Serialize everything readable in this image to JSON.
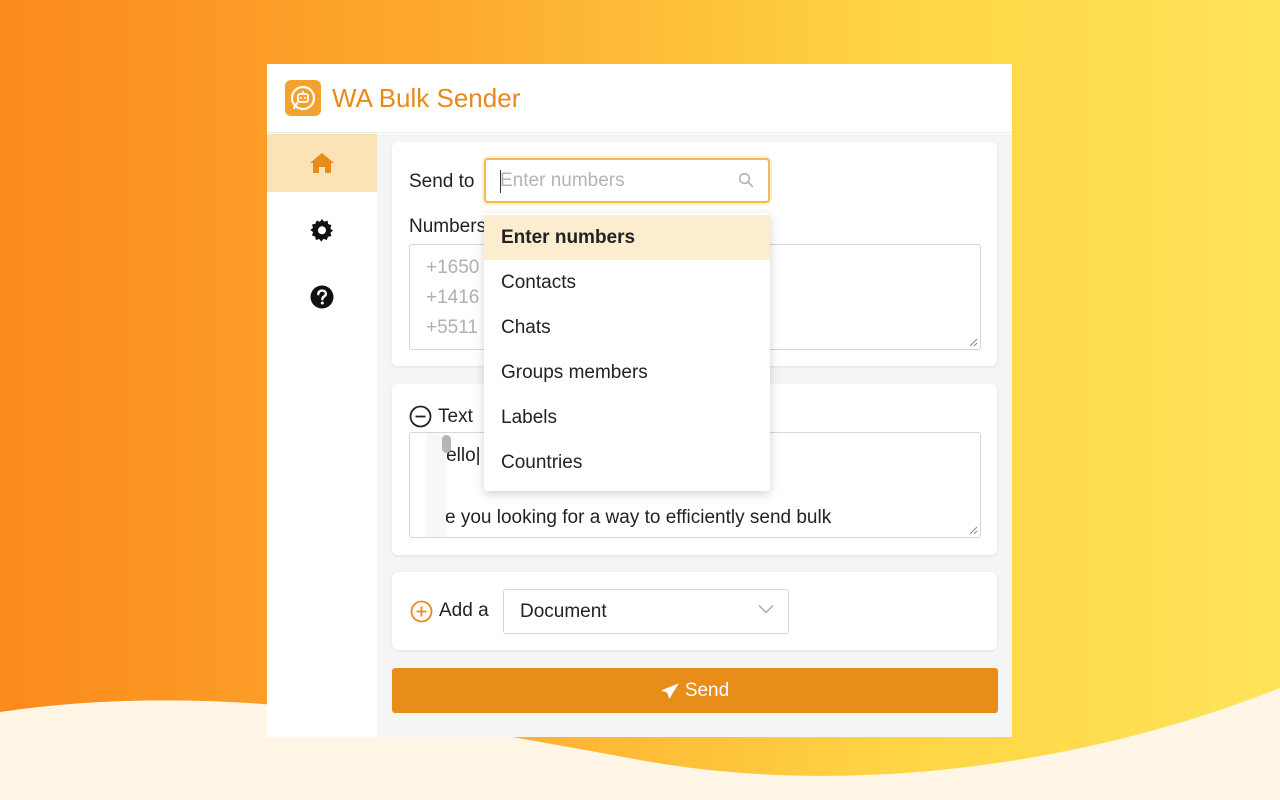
{
  "app": {
    "title": "WA Bulk Sender"
  },
  "colors": {
    "accent": "#e88c1a",
    "active_bg": "#fbe3b6",
    "focus": "#f2bb55"
  },
  "sidebar": {
    "items": [
      {
        "icon": "home-icon",
        "active": true
      },
      {
        "icon": "gear-icon",
        "active": false
      },
      {
        "icon": "question-icon",
        "active": false
      }
    ]
  },
  "send_to": {
    "label": "Send to",
    "placeholder": "Enter numbers",
    "value": ""
  },
  "numbers": {
    "label": "Numbers",
    "placeholder_lines": [
      "+1650",
      "+1416",
      "+5511"
    ]
  },
  "dropdown": {
    "options": [
      "Enter numbers",
      "Contacts",
      "Chats",
      "Groups members",
      "Labels",
      "Countries"
    ],
    "selected": "Enter numbers"
  },
  "text_section": {
    "label": "Text",
    "lines": [
      "{Hello|",
      "Are you looking for a way to efficiently send bulk"
    ]
  },
  "attachment": {
    "label": "Add a",
    "selected": "Document"
  },
  "send_button": {
    "label": "Send"
  }
}
